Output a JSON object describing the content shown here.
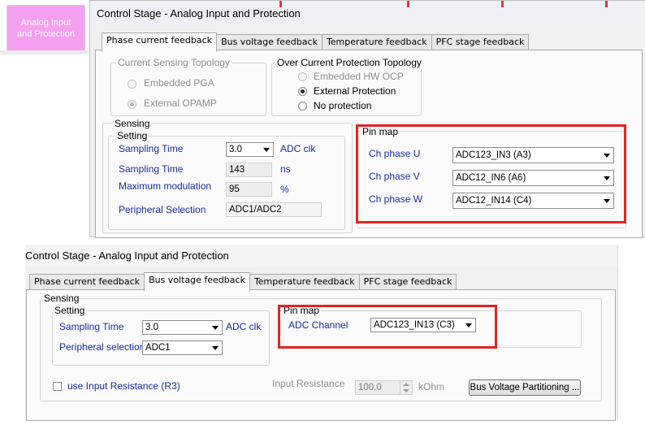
{
  "sidebar": {
    "button_line1": "Analog Input",
    "button_line2": "and Protection"
  },
  "window1": {
    "title": "Control Stage - Analog Input and Protection",
    "tabs": [
      "Phase current feedback",
      "Bus voltage feedback",
      "Temperature feedback",
      "PFC stage feedback"
    ],
    "active_tab": 0,
    "current_sensing": {
      "legend": "Current Sensing Topology",
      "options": [
        "Embedded PGA",
        "External OPAMP"
      ],
      "selected": 1,
      "disabled": true
    },
    "ocp": {
      "legend": "Over Current Protection Topology",
      "options": [
        "Embedded HW OCP",
        "External Protection",
        "No protection"
      ],
      "selected": 1
    },
    "sensing_legend": "Sensing",
    "setting": {
      "legend": "Setting",
      "sampling_time_label": "Sampling Time",
      "sampling_time_value": "3.0",
      "sampling_time_unit": "ADC clk",
      "sampling_time2_label": "Sampling Time",
      "sampling_time2_value": "143",
      "sampling_time2_unit": "ns",
      "max_mod_label": "Maximum modulation",
      "max_mod_value": "95",
      "max_mod_unit": "%",
      "peripheral_label": "Peripheral Selection",
      "peripheral_value": "ADC1/ADC2"
    },
    "pin_map": {
      "legend": "Pin map",
      "rows": [
        {
          "label": "Ch phase U",
          "value": "ADC123_IN3 (A3)"
        },
        {
          "label": "Ch phase V",
          "value": "ADC12_IN6 (A6)"
        },
        {
          "label": "Ch phase W",
          "value": "ADC12_IN14 (C4)"
        }
      ]
    }
  },
  "window2": {
    "title": "Control Stage - Analog Input and Protection",
    "tabs": [
      "Phase current feedback",
      "Bus voltage feedback",
      "Temperature feedback",
      "PFC stage feedback"
    ],
    "active_tab": 1,
    "sensing_legend": "Sensing",
    "setting": {
      "legend": "Setting",
      "sampling_time_label": "Sampling Time",
      "sampling_time_value": "3.0",
      "sampling_time_unit": "ADC clk",
      "peripheral_label": "Peripheral selection",
      "peripheral_value": "ADC1"
    },
    "pin_map": {
      "legend": "Pin map",
      "adc_channel_label": "ADC Channel",
      "adc_channel_value": "ADC123_IN13 (C3)"
    },
    "use_input_resistance_label": "use Input Resistance (R3)",
    "input_resistance_label": "Input Resistance",
    "input_resistance_value": "100.0",
    "input_resistance_unit": "kOhm",
    "partition_button": "Bus Voltage Partitioning ..."
  },
  "colors": {
    "highlight": "#e02424",
    "label_blue": "#1b2b9f",
    "pink_button": "#f49ff0"
  }
}
